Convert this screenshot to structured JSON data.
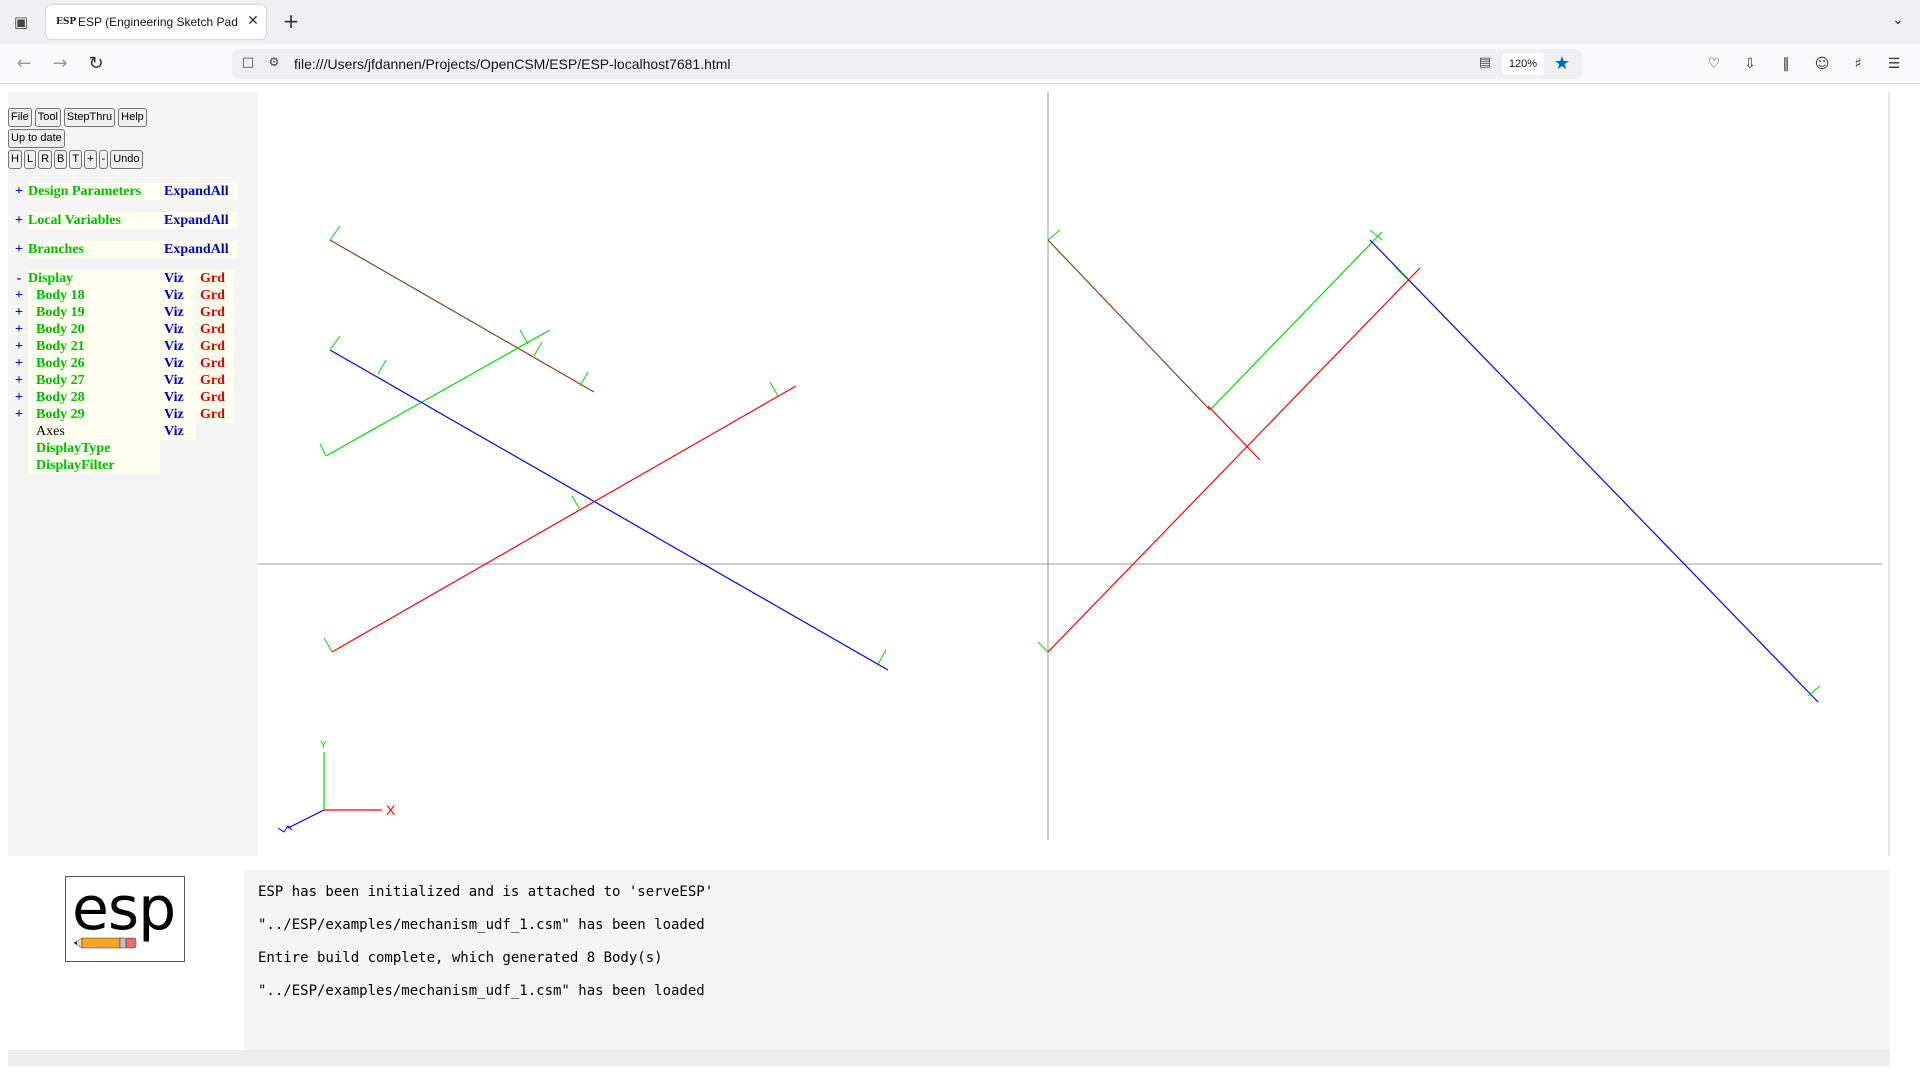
{
  "browser": {
    "tab_title": "ESP (Engineering Sketch Pad, V",
    "tab_favicon": "ESP",
    "url": "file:///Users/jfdannen/Projects/OpenCSM/ESP/ESP-localhost7681.html",
    "zoom": "120%",
    "icons": {
      "tab_list": "tab-list-icon",
      "close": "close-icon",
      "new_tab": "plus-icon",
      "back": "back-arrow-icon",
      "forward": "forward-arrow-icon",
      "reload": "reload-icon",
      "bookmark": "star-icon",
      "pocket": "pocket-icon",
      "downloads": "download-icon",
      "library": "library-icon",
      "account": "account-icon",
      "extensions": "extensions-icon",
      "menu": "hamburger-menu-icon"
    }
  },
  "esp": {
    "buttons_row1": [
      "File",
      "Tool",
      "StepThru",
      "Help"
    ],
    "status_button": "Up to date",
    "buttons_row3": [
      "H",
      "L",
      "R",
      "B",
      "T",
      "+",
      "-",
      "Undo"
    ],
    "tree": {
      "design_parameters": {
        "pm": "+",
        "label": "Design Parameters",
        "action": "ExpandAll"
      },
      "local_variables": {
        "pm": "+",
        "label": "Local Variables",
        "action": "ExpandAll"
      },
      "branches": {
        "pm": "+",
        "label": "Branches",
        "action": "ExpandAll"
      },
      "display": {
        "pm": "-",
        "label": "Display",
        "viz": "Viz",
        "grd": "Grd"
      },
      "bodies": [
        {
          "pm": "+",
          "label": "Body 18",
          "viz": "Viz",
          "grd": "Grd"
        },
        {
          "pm": "+",
          "label": "Body 19",
          "viz": "Viz",
          "grd": "Grd"
        },
        {
          "pm": "+",
          "label": "Body 20",
          "viz": "Viz",
          "grd": "Grd"
        },
        {
          "pm": "+",
          "label": "Body 21",
          "viz": "Viz",
          "grd": "Grd"
        },
        {
          "pm": "+",
          "label": "Body 26",
          "viz": "Viz",
          "grd": "Grd"
        },
        {
          "pm": "+",
          "label": "Body 27",
          "viz": "Viz",
          "grd": "Grd"
        },
        {
          "pm": "+",
          "label": "Body 28",
          "viz": "Viz",
          "grd": "Grd"
        },
        {
          "pm": "+",
          "label": "Body 29",
          "viz": "Viz",
          "grd": "Grd"
        }
      ],
      "axes": {
        "label": "Axes",
        "viz": "Viz"
      },
      "display_type": "DisplayType",
      "display_filter": "DisplayFilter"
    },
    "axes_triad": {
      "x_label": "X",
      "y_label": "Y"
    },
    "logo_text": "esp",
    "messages": [
      "ESP has been initialized and is attached to 'serveESP'",
      "\"../ESP/examples/mechanism_udf_1.csm\" has been loaded",
      "Entire build complete, which generated 8 Body(s)",
      "\"../ESP/examples/mechanism_udf_1.csm\" has been loaded"
    ],
    "colors": {
      "tree_label": "#00bb00",
      "tree_action": "#0000cc",
      "tree_grd": "#dd0000",
      "edge_red": "#ff0000",
      "edge_green": "#00dd00",
      "edge_blue": "#0000ff",
      "edge_brown": "#884422"
    }
  }
}
